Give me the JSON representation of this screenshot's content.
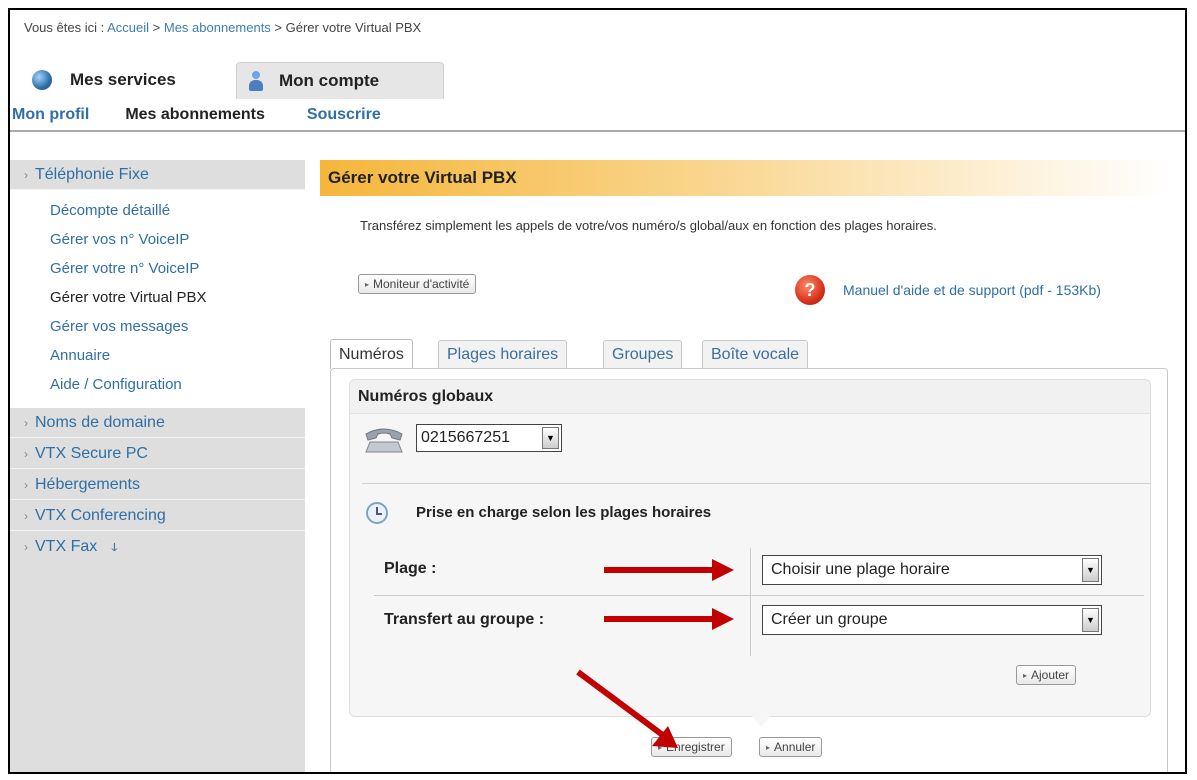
{
  "breadcrumb": {
    "prefix": "Vous êtes ici : ",
    "home": "Accueil",
    "sep1": " > ",
    "subscriptions": "Mes abonnements",
    "sep2": " > ",
    "current": "Gérer votre Virtual PBX"
  },
  "top_tabs": [
    "Mes services",
    "Mon compte"
  ],
  "sub_nav": [
    "Mon profil",
    "Mes abonnements",
    "Souscrire"
  ],
  "sidebar": {
    "section_open": "Téléphonie Fixe",
    "links": [
      "Décompte détaillé",
      "Gérer vos n° VoiceIP",
      "Gérer votre n° VoiceIP",
      "Gérer votre Virtual PBX",
      "Gérer vos messages",
      "Annuaire",
      "Aide / Configuration"
    ],
    "sections": [
      "Noms de domaine",
      "VTX Secure PC",
      "Hébergements",
      "VTX Conferencing",
      "VTX Fax"
    ],
    "external_icon": "ↆ"
  },
  "main": {
    "title": "Gérer votre Virtual PBX",
    "description": "Transférez simplement les appels de votre/vos numéro/s global/aux en fonction des plages horaires.",
    "monitor_button": "Moniteur d'activité",
    "help_link": "Manuel d'aide et de support (pdf - 153Kb)",
    "help_icon_glyph": "?",
    "tabs": [
      "Numéros",
      "Plages horaires",
      "Groupes",
      "Boîte vocale"
    ],
    "panel_title": "Numéros globaux",
    "number_value": "0215667251",
    "section_title": "Prise en charge selon les plages horaires",
    "plage_label": "Plage :",
    "plage_value": "Choisir une plage horaire",
    "transfer_label": "Transfert au groupe :",
    "transfer_value": "Créer un groupe",
    "add_button": "Ajouter",
    "save_button": "Enregistrer",
    "cancel_button": "Annuler"
  },
  "colors": {
    "link": "#2f6fa6",
    "header_gradient": "#f5b63b",
    "arrow": "#c20000"
  }
}
